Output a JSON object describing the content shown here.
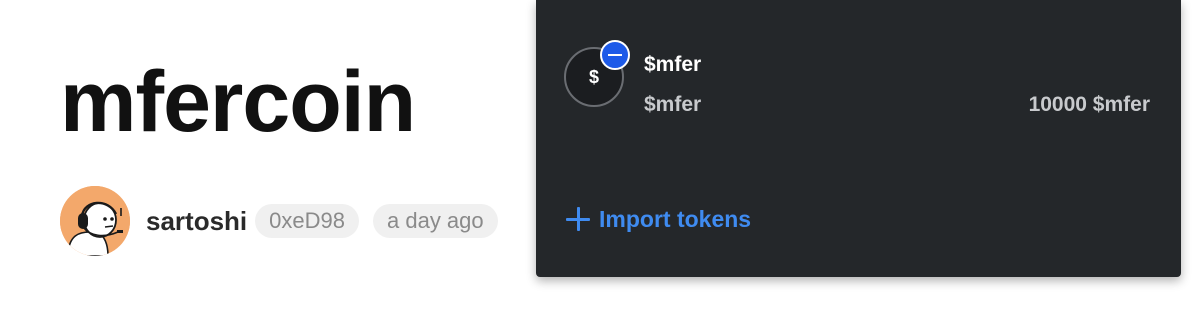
{
  "article": {
    "title": "mfercoin",
    "author": "sartoshi",
    "address": "0xeD98",
    "posted": "a day ago"
  },
  "wallet": {
    "token": {
      "icon_glyph": "$",
      "symbol": "$mfer",
      "name": "$mfer",
      "balance": "10000 $mfer"
    },
    "import_label": "Import tokens",
    "colors": {
      "background": "#24272a",
      "accent": "#3f8bf0",
      "remove_badge": "#1d5ae8"
    }
  },
  "icons": [
    "avatar",
    "token-icon",
    "remove-icon",
    "plus-icon"
  ]
}
